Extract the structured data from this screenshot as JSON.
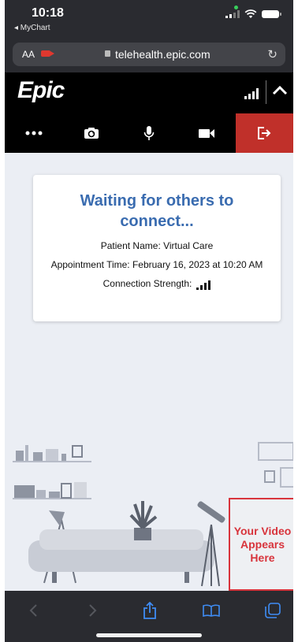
{
  "status_bar": {
    "time": "10:18",
    "back_app": "◂ MyChart"
  },
  "browser": {
    "text_size_button": "AA",
    "url": "telehealth.epic.com"
  },
  "header": {
    "logo": "Epic"
  },
  "toolbar": {
    "buttons": [
      {
        "name": "more-options",
        "icon": "ellipsis-icon"
      },
      {
        "name": "switch-camera",
        "icon": "camera-switch-icon"
      },
      {
        "name": "microphone",
        "icon": "microphone-icon"
      },
      {
        "name": "video",
        "icon": "video-camera-icon"
      },
      {
        "name": "leave-call",
        "icon": "exit-icon"
      }
    ],
    "leave_color": "#c0302a"
  },
  "waiting_card": {
    "title": "Waiting for others to connect...",
    "patient_name": "Patient Name: Virtual Care",
    "appointment_time": "Appointment Time: February 16, 2023 at 10:20 AM",
    "connection_strength_label": "Connection Strength:"
  },
  "self_video": {
    "label": "Your Video Appears Here",
    "color": "#d8343c"
  },
  "colors": {
    "title_blue": "#3a6cb0",
    "page_bg": "#ebeef4"
  }
}
